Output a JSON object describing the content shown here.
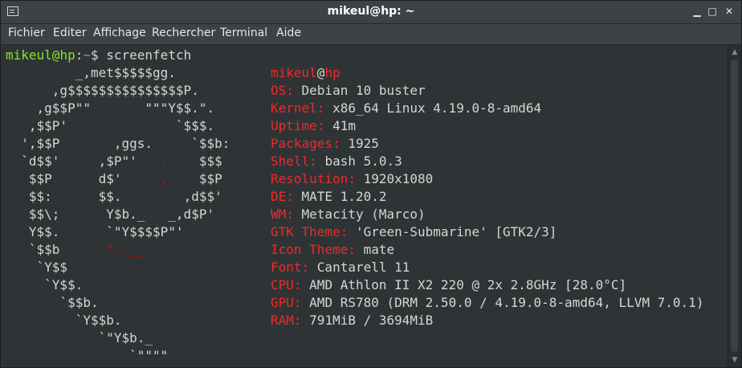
{
  "window": {
    "title": "mikeul@hp: ~",
    "buttons": {
      "minimize": "▁",
      "maximize": "□",
      "close": "✕"
    }
  },
  "menu": [
    "Fichier",
    "Editer",
    "Affichage",
    "Rechercher",
    "Terminal",
    "Aide"
  ],
  "prompt": {
    "user": "mikeul",
    "at": "@",
    "host": "hp",
    "colon": ":",
    "path": "~",
    "symbol": "$ ",
    "command": "screenfetch"
  },
  "logo": [
    {
      "w": "         _,met$$$$$gg."
    },
    {
      "w": "      ,g$$$$$$$$$$$$$$$P."
    },
    {
      "w": "    ,g$$P\"\"       \"\"\"Y$$.\"."
    },
    {
      "w": "   ,$$P'              `$$$."
    },
    {
      "w": "  ',$$P       ,ggs.     `$$b:"
    },
    {
      "w": "  `d$$'     ,$P\"'   ",
      "r": ".",
      "w2": "    $$$"
    },
    {
      "w": "   $$P      d$'     ",
      "r": ",",
      "w2": "    $$P"
    },
    {
      "w": "   $$:      $$.   ",
      "r": "-",
      "w2": "    ,d$$'"
    },
    {
      "w": "   $$\\;      Y$b._   _,d$P'"
    },
    {
      "w": "   Y$$.    ",
      "r": "`.",
      "w2": "`\"Y$$$$P\"'"
    },
    {
      "w": "   `$$b      ",
      "r": "\"-.__"
    },
    {
      "w": "    `Y$$"
    },
    {
      "w": "     `Y$$."
    },
    {
      "w": "       `$$b."
    },
    {
      "w": "         `Y$$b."
    },
    {
      "w": "            `\"Y$b._"
    },
    {
      "w": "                `\"\"\"\""
    }
  ],
  "info": {
    "header": {
      "user": "mikeul",
      "at": "@",
      "host": "hp"
    },
    "rows": [
      {
        "label": "OS: ",
        "value": "Debian 10 buster"
      },
      {
        "label": "Kernel: ",
        "value": "x86_64 Linux 4.19.0-8-amd64"
      },
      {
        "label": "Uptime: ",
        "value": "41m"
      },
      {
        "label": "Packages: ",
        "value": "1925"
      },
      {
        "label": "Shell: ",
        "value": "bash 5.0.3"
      },
      {
        "label": "Resolution: ",
        "value": "1920x1080"
      },
      {
        "label": "DE: ",
        "value": "MATE 1.20.2"
      },
      {
        "label": "WM: ",
        "value": "Metacity (Marco)"
      },
      {
        "label": "GTK Theme: ",
        "value": "'Green-Submarine' [GTK2/3]"
      },
      {
        "label": "Icon Theme: ",
        "value": "mate"
      },
      {
        "label": "Font: ",
        "value": "Cantarell 11"
      },
      {
        "label": "CPU: ",
        "value": "AMD Athlon II X2 220 @ 2x 2.8GHz [28.0°C]"
      },
      {
        "label": "GPU: ",
        "value": "AMD RS780 (DRM 2.50.0 / 4.19.0-8-amd64, LLVM 7.0.1)"
      },
      {
        "label": "RAM: ",
        "value": "791MiB / 3694MiB"
      }
    ]
  },
  "colors": {
    "prompt_user": "#8ae234",
    "prompt_path": "#729fcf",
    "label": "#ef2929",
    "logo_accent": "#cc0000",
    "text": "#d3d7cf",
    "background": "#2e3436"
  }
}
